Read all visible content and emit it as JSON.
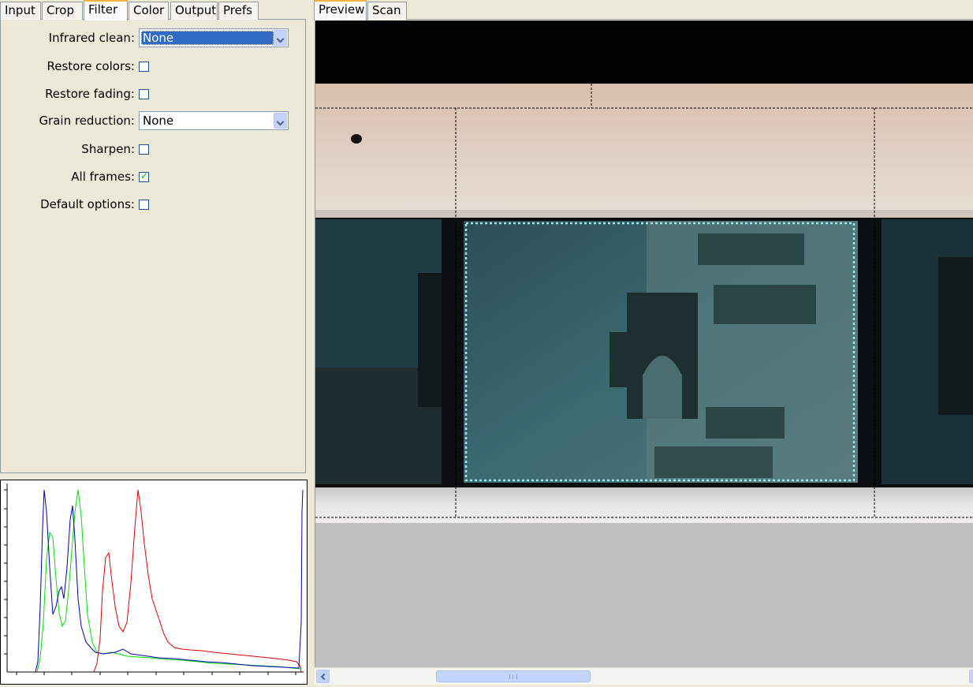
{
  "left_tabs": [
    {
      "label": "Input",
      "active": false
    },
    {
      "label": "Crop",
      "active": false
    },
    {
      "label": "Filter",
      "active": true
    },
    {
      "label": "Color",
      "active": false
    },
    {
      "label": "Output",
      "active": false
    },
    {
      "label": "Prefs",
      "active": false
    }
  ],
  "right_tabs": [
    {
      "label": "Preview",
      "active": true
    },
    {
      "label": "Scan",
      "active": false
    }
  ],
  "filter": {
    "infrared_clean": {
      "label": "Infrared clean:",
      "value": "None"
    },
    "restore_colors": {
      "label": "Restore colors:",
      "checked": false
    },
    "restore_fading": {
      "label": "Restore fading:",
      "checked": false
    },
    "grain_reduction": {
      "label": "Grain reduction:",
      "value": "None"
    },
    "sharpen": {
      "label": "Sharpen:",
      "checked": false
    },
    "all_frames": {
      "label": "All frames:",
      "checked": true
    },
    "default_options": {
      "label": "Default options:",
      "checked": false
    }
  },
  "histogram": {
    "colors": {
      "red": "#e00000",
      "green": "#00e000",
      "blue": "#0000c0"
    }
  },
  "colors": {
    "selection_highlight": "#316ac5",
    "active_tab_accent": "#f2b43c",
    "checkmark": "#21a121"
  },
  "icons": {
    "checkbox_checked": "check-mark",
    "dropdown": "chevron-down-icon",
    "scroll_left": "chevron-left-icon",
    "scroll_right": "chevron-right-icon"
  }
}
